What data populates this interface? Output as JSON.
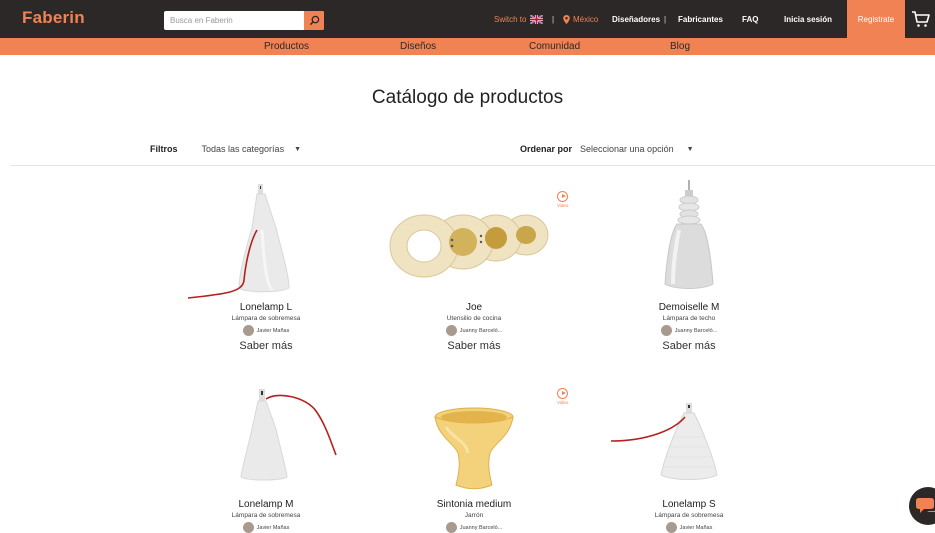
{
  "header": {
    "logo": "Faberin",
    "search_placeholder": "Busca en Faberin",
    "switch_to": "Switch to",
    "location": "México",
    "links": [
      "Diseñadores",
      "Fabricantes",
      "FAQ",
      "Inicia sesión"
    ],
    "register": "Registrate"
  },
  "subnav": [
    "Productos",
    "Diseños",
    "Comunidad",
    "Blog"
  ],
  "page_title": "Catálogo de productos",
  "filters": {
    "label": "Filtros",
    "category_value": "Todas las categorías",
    "sort_label": "Ordenar por",
    "sort_value": "Seleccionar una opción"
  },
  "products": [
    {
      "name": "Lonelamp L",
      "category": "Lámpara de sobremesa",
      "designer": "Javier Mañas",
      "more": "Saber más"
    },
    {
      "name": "Joe",
      "category": "Utensilio de cocina",
      "designer": "Juanny Barceló...",
      "more": "Saber más",
      "video": "Video"
    },
    {
      "name": "Demoiselle M",
      "category": "Lámpara de techo",
      "designer": "Juanny Barceló...",
      "more": "Saber más"
    },
    {
      "name": "Lonelamp M",
      "category": "Lámpara de sobremesa",
      "designer": "Javier Mañas"
    },
    {
      "name": "Sintonia medium",
      "category": "Jarrón",
      "designer": "Juanny Barceló...",
      "video": "Video"
    },
    {
      "name": "Lonelamp S",
      "category": "Lámpara de sobremesa",
      "designer": "Javier Mañas"
    }
  ],
  "colors": {
    "accent": "#f08254",
    "dark": "#2b2827"
  }
}
